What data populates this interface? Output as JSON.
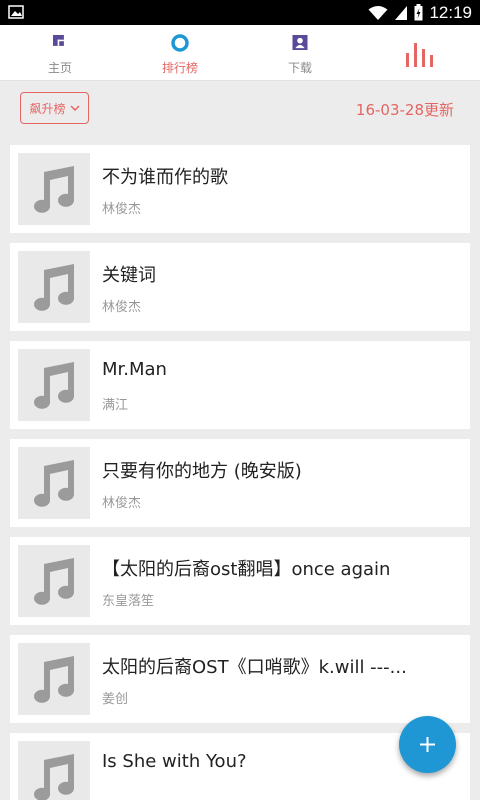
{
  "status_bar": {
    "time": "12:19"
  },
  "nav": {
    "home_label": "主页",
    "charts_label": "排行榜",
    "download_label": "下载"
  },
  "filter": {
    "dropdown_label": "飙升榜",
    "update_text": "16-03-28更新"
  },
  "songs": [
    {
      "title": "不为谁而作的歌",
      "artist": "林俊杰"
    },
    {
      "title": "关键词",
      "artist": "林俊杰"
    },
    {
      "title": "Mr.Man",
      "artist": "满江"
    },
    {
      "title": "只要有你的地方 (晚安版)",
      "artist": "林俊杰"
    },
    {
      "title": "【太阳的后裔ost翻唱】once again",
      "artist": "东皇落笙"
    },
    {
      "title": "太阳的后裔OST《口哨歌》k.will ---...",
      "artist": "姜创"
    },
    {
      "title": "Is She with You?",
      "artist": ""
    }
  ],
  "colors": {
    "accent": "#e46663",
    "fab": "#1e97d4",
    "nav_icon": "#5b4a99"
  },
  "icons": {
    "fab": "plus-icon",
    "eq": "equalizer-icon"
  }
}
